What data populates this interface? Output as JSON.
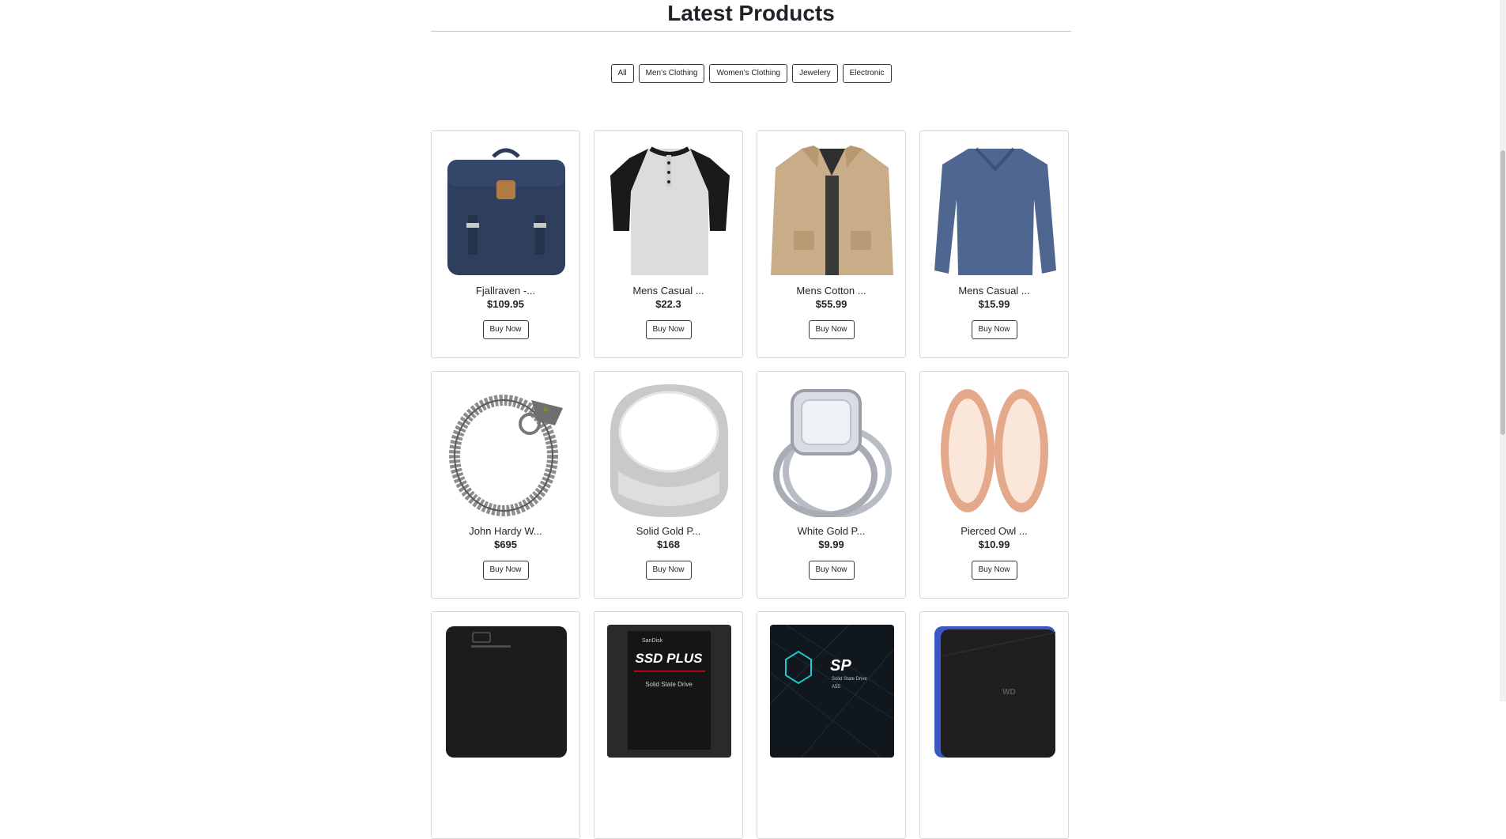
{
  "heading": "Latest Products",
  "filters": [
    "All",
    "Men's Clothing",
    "Women's Clothing",
    "Jewelery",
    "Electronic"
  ],
  "products": [
    {
      "name": "Fjallraven -...",
      "price": "$109.95",
      "button": "Buy Now",
      "image": "backpack"
    },
    {
      "name": "Mens Casual ...",
      "price": "$22.3",
      "button": "Buy Now",
      "image": "raglan-tshirt"
    },
    {
      "name": "Mens Cotton ...",
      "price": "$55.99",
      "button": "Buy Now",
      "image": "cotton-jacket"
    },
    {
      "name": "Mens Casual ...",
      "price": "$15.99",
      "button": "Buy Now",
      "image": "long-sleeve-shirt"
    },
    {
      "name": "John Hardy W...",
      "price": "$695",
      "button": "Buy Now",
      "image": "dragon-bracelet"
    },
    {
      "name": "Solid Gold P...",
      "price": "$168",
      "button": "Buy Now",
      "image": "silver-ring"
    },
    {
      "name": "White Gold P...",
      "price": "$9.99",
      "button": "Buy Now",
      "image": "diamond-ring"
    },
    {
      "name": "Pierced Owl ...",
      "price": "$10.99",
      "button": "Buy Now",
      "image": "rose-gold-plugs"
    },
    {
      "name": "",
      "price": "",
      "button": "",
      "image": "external-hard-drive"
    },
    {
      "name": "",
      "price": "",
      "button": "",
      "image": "sandisk-ssd",
      "image_text": [
        "SanDisk",
        "SSD PLUS",
        "Solid State Drive"
      ]
    },
    {
      "name": "",
      "price": "",
      "button": "",
      "image": "silicon-power-ssd",
      "image_text": [
        "SP",
        "Solid State Drive",
        "A55"
      ]
    },
    {
      "name": "",
      "price": "",
      "button": "",
      "image": "wd-gaming-drive",
      "image_text": [
        "WD"
      ]
    }
  ]
}
